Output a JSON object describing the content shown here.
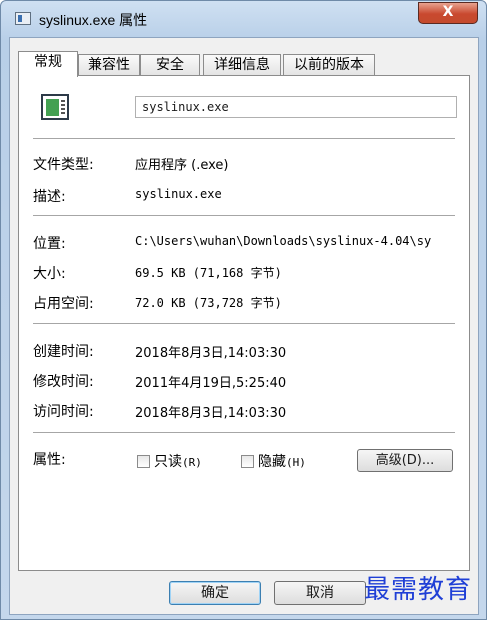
{
  "window": {
    "title": "syslinux.exe 属性",
    "close_glyph": "X"
  },
  "tabs": [
    {
      "label": "常规",
      "active": true
    },
    {
      "label": "兼容性"
    },
    {
      "label": "安全"
    },
    {
      "label": "详细信息"
    },
    {
      "label": "以前的版本"
    }
  ],
  "general": {
    "filename": "syslinux.exe",
    "rows": {
      "type": {
        "label": "文件类型:",
        "value": "应用程序 (.exe)"
      },
      "desc": {
        "label": "描述:",
        "value": "syslinux.exe"
      },
      "location": {
        "label": "位置:",
        "value": "C:\\Users\\wuhan\\Downloads\\syslinux-4.04\\sy"
      },
      "size": {
        "label": "大小:",
        "value": "69.5 KB (71,168 字节)"
      },
      "disk": {
        "label": "占用空间:",
        "value": "72.0 KB (73,728 字节)"
      },
      "created": {
        "label": "创建时间:",
        "value": "2018年8月3日,14:03:30"
      },
      "modified": {
        "label": "修改时间:",
        "value": "2011年4月19日,5:25:40"
      },
      "accessed": {
        "label": "访问时间:",
        "value": "2018年8月3日,14:03:30"
      }
    },
    "attributes": {
      "label": "属性:",
      "readonly": {
        "text": "只读",
        "key": "(R)",
        "checked": false
      },
      "hidden": {
        "text": "隐藏",
        "key": "(H)",
        "checked": false
      },
      "advanced_label": "高级(D)..."
    }
  },
  "buttons": {
    "ok": "确定",
    "cancel": "取消"
  },
  "watermark": "最需教育"
}
